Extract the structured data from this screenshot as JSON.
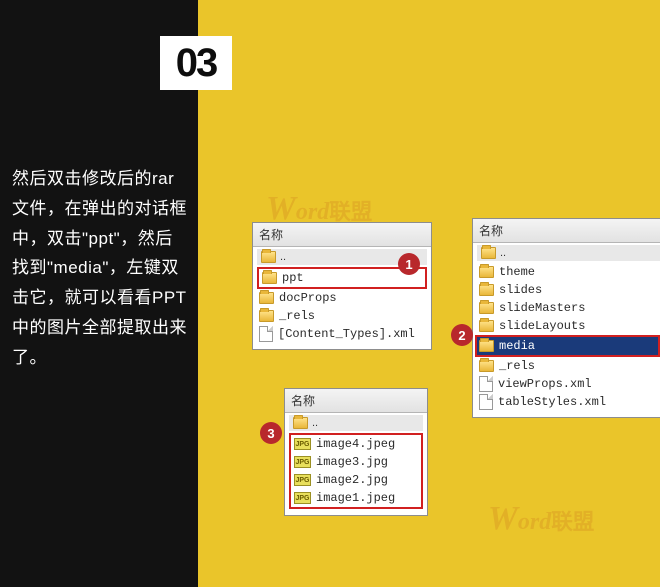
{
  "step_number": "03",
  "instruction_text": "然后双击修改后的rar文件，在弹出的对话框中，双击\"ppt\"，然后找到\"media\"，左键双击它，就可以看看PPT中的图片全部提取出来了。",
  "panel1": {
    "header": "名称",
    "parent_row": "..",
    "items": [
      {
        "type": "folder",
        "label": "ppt",
        "highlighted_red": true
      },
      {
        "type": "folder",
        "label": "docProps"
      },
      {
        "type": "folder",
        "label": "_rels"
      },
      {
        "type": "file",
        "label": "[Content_Types].xml"
      }
    ]
  },
  "panel2": {
    "header": "名称",
    "parent_row": "..",
    "items": [
      {
        "type": "folder",
        "label": "theme"
      },
      {
        "type": "folder",
        "label": "slides"
      },
      {
        "type": "folder",
        "label": "slideMasters"
      },
      {
        "type": "folder",
        "label": "slideLayouts"
      },
      {
        "type": "folder",
        "label": "media",
        "highlighted_blue": true,
        "highlighted_red": true
      },
      {
        "type": "folder",
        "label": "_rels"
      },
      {
        "type": "file",
        "label": "viewProps.xml"
      },
      {
        "type": "file",
        "label": "tableStyles.xml"
      }
    ]
  },
  "panel3": {
    "header": "名称",
    "parent_row": "..",
    "items": [
      {
        "type": "jpg",
        "label": "image4.jpeg"
      },
      {
        "type": "jpg",
        "label": "image3.jpg"
      },
      {
        "type": "jpg",
        "label": "image2.jpg"
      },
      {
        "type": "jpg",
        "label": "image1.jpeg"
      }
    ]
  },
  "badges": {
    "one": "1",
    "two": "2",
    "three": "3"
  },
  "watermark": {
    "brand_en": "Word",
    "brand_cn": "联盟"
  },
  "icon_labels": {
    "jpg": "JPG"
  }
}
